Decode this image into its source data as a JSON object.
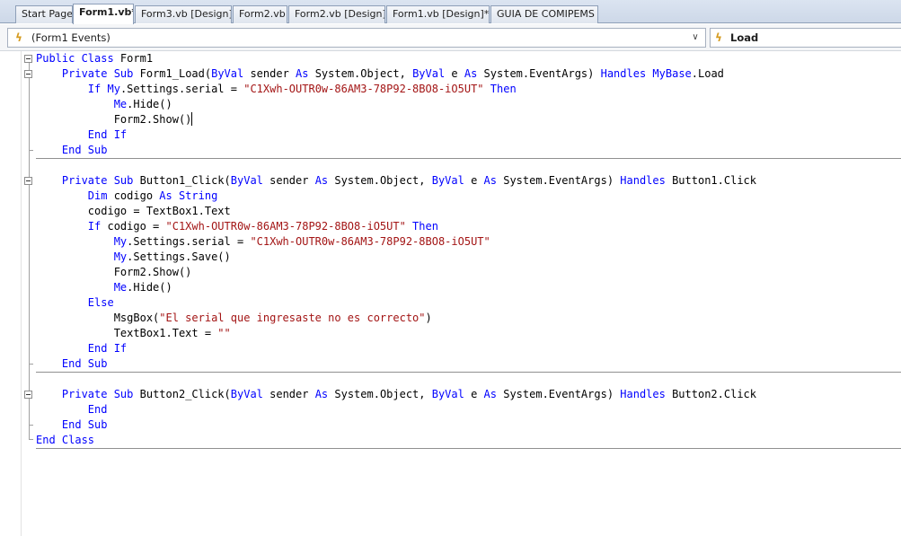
{
  "tabs": [
    {
      "label": "Start Page"
    },
    {
      "label": "Form1.vb*"
    },
    {
      "label": "Form3.vb [Design]"
    },
    {
      "label": "Form2.vb"
    },
    {
      "label": "Form2.vb [Design]"
    },
    {
      "label": "Form1.vb [Design]*"
    },
    {
      "label": "GUIA DE COMIPEMS"
    }
  ],
  "active_tab_index": 1,
  "dropdowns": {
    "class_name": "(Form1 Events)",
    "method_name": "Load"
  },
  "colors": {
    "keyword": "#0000ff",
    "string": "#a31515",
    "text": "#000000"
  },
  "code": {
    "l1_kw": "Public Class",
    "l1_txt": " Form1",
    "l2_kw1": "Private Sub",
    "l2_txt1": " Form1_Load(",
    "l2_kw2": "ByVal",
    "l2_txt2": " sender ",
    "l2_kw3": "As",
    "l2_txt3": " System.Object, ",
    "l2_kw4": "ByVal",
    "l2_txt4": " e ",
    "l2_kw5": "As",
    "l2_txt5": " System.EventArgs) ",
    "l2_kw6": "Handles",
    "l2_kw7": "MyBase",
    "l2_txt6": ".Load",
    "l3_kw1": "If",
    "l3_kw2": "My",
    "l3_txt1": ".Settings.serial = ",
    "l3_str": "\"C1Xwh-OUTR0w-86AM3-78P92-8BO8-iO5UT\"",
    "l3_kw3": "Then",
    "l4_kw": "Me",
    "l4_txt": ".Hide()",
    "l5_txt": "Form2.Show()",
    "l6_kw": "End If",
    "l7_kw": "End Sub",
    "l9_kw1": "Private Sub",
    "l9_txt1": " Button1_Click(",
    "l9_kw2": "ByVal",
    "l9_txt2": " sender ",
    "l9_kw3": "As",
    "l9_txt3": " System.Object, ",
    "l9_kw4": "ByVal",
    "l9_txt4": " e ",
    "l9_kw5": "As",
    "l9_txt5": " System.EventArgs) ",
    "l9_kw6": "Handles",
    "l9_txt6": " Button1.Click",
    "l10_kw1": "Dim",
    "l10_txt": " codigo ",
    "l10_kw2": "As String",
    "l11_txt": "codigo = TextBox1.Text",
    "l12_kw1": "If",
    "l12_txt": " codigo = ",
    "l12_str": "\"C1Xwh-OUTR0w-86AM3-78P92-8BO8-iO5UT\"",
    "l12_kw2": "Then",
    "l13_kw": "My",
    "l13_txt": ".Settings.serial = ",
    "l13_str": "\"C1Xwh-OUTR0w-86AM3-78P92-8BO8-iO5UT\"",
    "l14_kw": "My",
    "l14_txt": ".Settings.Save()",
    "l15_txt": "Form2.Show()",
    "l16_kw": "Me",
    "l16_txt": ".Hide()",
    "l17_kw": "Else",
    "l18_txt1": "MsgBox(",
    "l18_str": "\"El serial que ingresaste no es correcto\"",
    "l18_txt2": ")",
    "l19_txt": "TextBox1.Text = ",
    "l19_str": "\"\"",
    "l20_kw": "End If",
    "l21_kw": "End Sub",
    "l23_kw1": "Private Sub",
    "l23_txt1": " Button2_Click(",
    "l23_kw2": "ByVal",
    "l23_txt2": " sender ",
    "l23_kw3": "As",
    "l23_txt3": " System.Object, ",
    "l23_kw4": "ByVal",
    "l23_txt4": " e ",
    "l23_kw5": "As",
    "l23_txt5": " System.EventArgs) ",
    "l23_kw6": "Handles",
    "l23_txt6": " Button2.Click",
    "l24_kw": "End",
    "l25_kw": "End Sub",
    "l26_kw": "End Class"
  }
}
